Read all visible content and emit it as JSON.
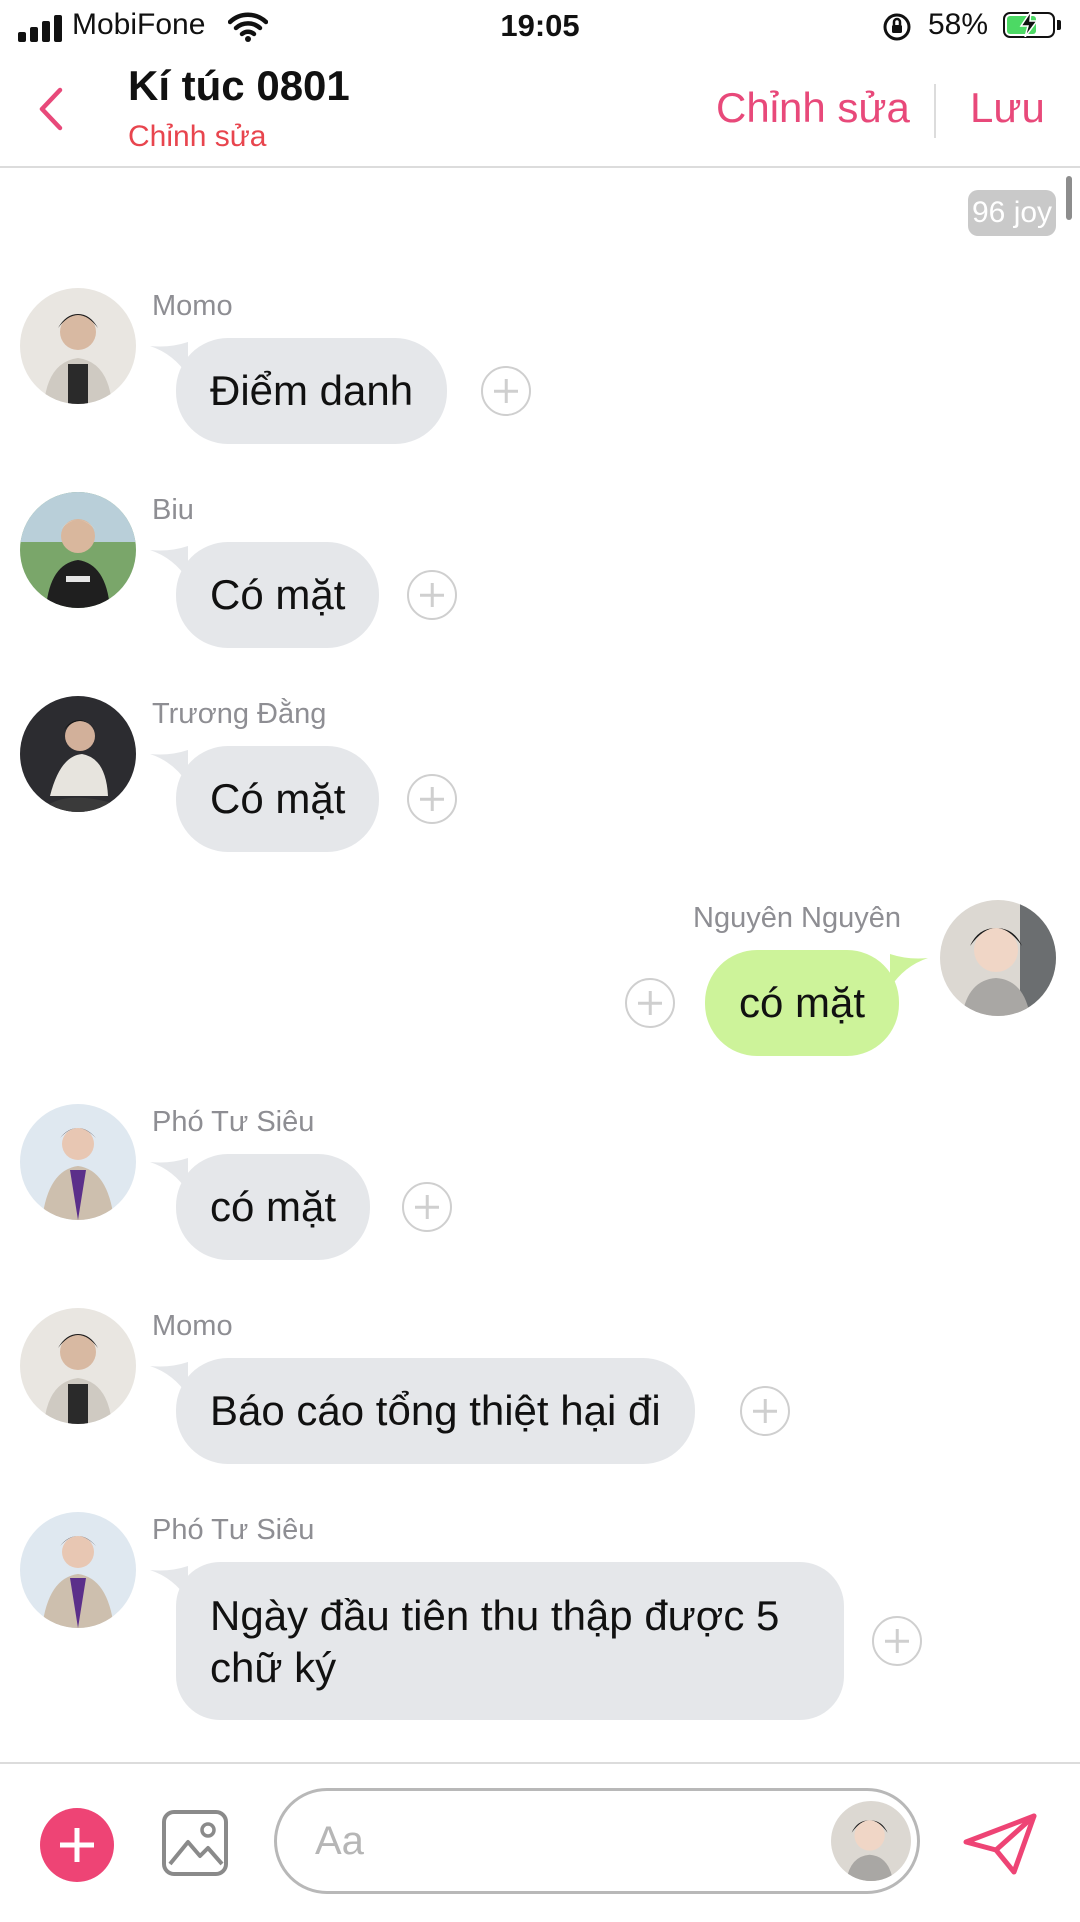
{
  "status_bar": {
    "carrier": "MobiFone",
    "time": "19:05",
    "battery_percent": "58%",
    "battery_level": 0.58
  },
  "header": {
    "title": "Kí túc 0801",
    "subtitle": "Chỉnh sửa",
    "edit_label": "Chỉnh sửa",
    "save_label": "Lưu",
    "back_icon": "chevron-left-icon",
    "accent_color": "#e8497a"
  },
  "chat": {
    "joy_badge": "96 joy",
    "messages": [
      {
        "sender": "Momo",
        "text": "Điểm danh",
        "direction": "incoming"
      },
      {
        "sender": "Biu",
        "text": "Có mặt",
        "direction": "incoming"
      },
      {
        "sender": "Trương Đằng",
        "text": "Có mặt",
        "direction": "incoming"
      },
      {
        "sender": "Nguyên Nguyên",
        "text": "có mặt",
        "direction": "outgoing"
      },
      {
        "sender": "Phó Tư Siêu",
        "text": "có mặt",
        "direction": "incoming"
      },
      {
        "sender": "Momo",
        "text": "Báo cáo tổng thiệt hại đi",
        "direction": "incoming"
      },
      {
        "sender": "Phó Tư Siêu",
        "text_line1": "Ngày đầu tiên thu thập được 5",
        "text_line2": "chữ ký",
        "direction": "incoming"
      }
    ],
    "incoming_bubble_color": "#e5e7ea",
    "outgoing_bubble_color": "#cdf39a"
  },
  "composer": {
    "placeholder": "Aa",
    "add_icon": "plus-circle-icon",
    "image_icon": "image-icon",
    "send_icon": "paper-plane-icon",
    "add_color": "#ee4475"
  }
}
